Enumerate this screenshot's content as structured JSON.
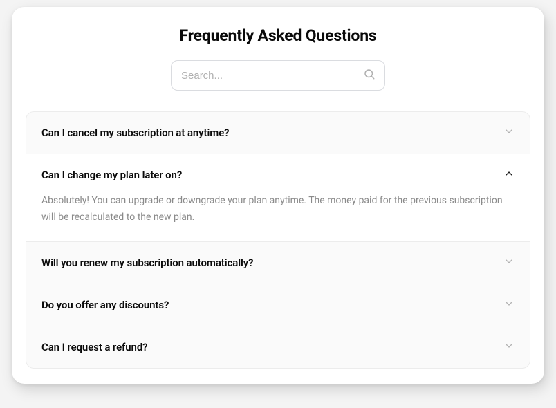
{
  "title": "Frequently Asked Questions",
  "search": {
    "placeholder": "Search..."
  },
  "faq": [
    {
      "question": "Can I cancel my subscription at anytime?",
      "expanded": false
    },
    {
      "question": "Can I change my plan later on?",
      "answer": "Absolutely! You can upgrade or downgrade your plan anytime. The money paid for the previous subscription will be recalculated to the new plan.",
      "expanded": true
    },
    {
      "question": "Will you renew my subscription automatically?",
      "expanded": false
    },
    {
      "question": "Do you offer any discounts?",
      "expanded": false
    },
    {
      "question": "Can I request a refund?",
      "expanded": false
    }
  ]
}
